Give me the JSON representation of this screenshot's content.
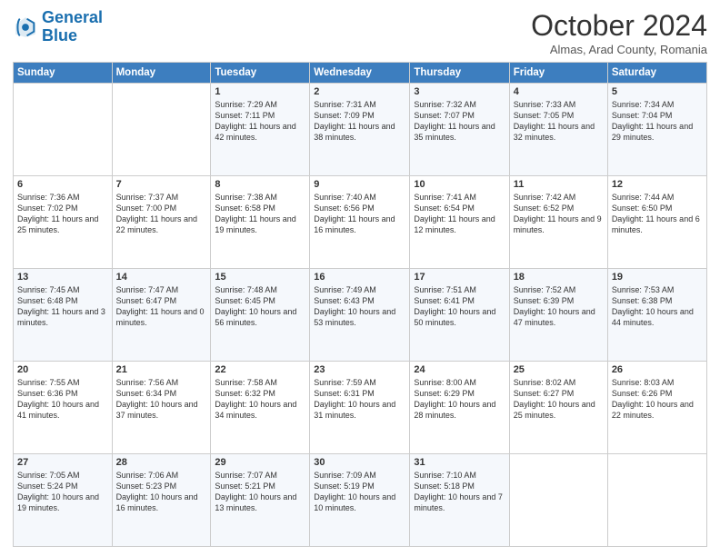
{
  "header": {
    "logo_line1": "General",
    "logo_line2": "Blue",
    "month_title": "October 2024",
    "subtitle": "Almas, Arad County, Romania"
  },
  "weekdays": [
    "Sunday",
    "Monday",
    "Tuesday",
    "Wednesday",
    "Thursday",
    "Friday",
    "Saturday"
  ],
  "rows": [
    [
      {
        "day": "",
        "text": ""
      },
      {
        "day": "",
        "text": ""
      },
      {
        "day": "1",
        "text": "Sunrise: 7:29 AM\nSunset: 7:11 PM\nDaylight: 11 hours and 42 minutes."
      },
      {
        "day": "2",
        "text": "Sunrise: 7:31 AM\nSunset: 7:09 PM\nDaylight: 11 hours and 38 minutes."
      },
      {
        "day": "3",
        "text": "Sunrise: 7:32 AM\nSunset: 7:07 PM\nDaylight: 11 hours and 35 minutes."
      },
      {
        "day": "4",
        "text": "Sunrise: 7:33 AM\nSunset: 7:05 PM\nDaylight: 11 hours and 32 minutes."
      },
      {
        "day": "5",
        "text": "Sunrise: 7:34 AM\nSunset: 7:04 PM\nDaylight: 11 hours and 29 minutes."
      }
    ],
    [
      {
        "day": "6",
        "text": "Sunrise: 7:36 AM\nSunset: 7:02 PM\nDaylight: 11 hours and 25 minutes."
      },
      {
        "day": "7",
        "text": "Sunrise: 7:37 AM\nSunset: 7:00 PM\nDaylight: 11 hours and 22 minutes."
      },
      {
        "day": "8",
        "text": "Sunrise: 7:38 AM\nSunset: 6:58 PM\nDaylight: 11 hours and 19 minutes."
      },
      {
        "day": "9",
        "text": "Sunrise: 7:40 AM\nSunset: 6:56 PM\nDaylight: 11 hours and 16 minutes."
      },
      {
        "day": "10",
        "text": "Sunrise: 7:41 AM\nSunset: 6:54 PM\nDaylight: 11 hours and 12 minutes."
      },
      {
        "day": "11",
        "text": "Sunrise: 7:42 AM\nSunset: 6:52 PM\nDaylight: 11 hours and 9 minutes."
      },
      {
        "day": "12",
        "text": "Sunrise: 7:44 AM\nSunset: 6:50 PM\nDaylight: 11 hours and 6 minutes."
      }
    ],
    [
      {
        "day": "13",
        "text": "Sunrise: 7:45 AM\nSunset: 6:48 PM\nDaylight: 11 hours and 3 minutes."
      },
      {
        "day": "14",
        "text": "Sunrise: 7:47 AM\nSunset: 6:47 PM\nDaylight: 11 hours and 0 minutes."
      },
      {
        "day": "15",
        "text": "Sunrise: 7:48 AM\nSunset: 6:45 PM\nDaylight: 10 hours and 56 minutes."
      },
      {
        "day": "16",
        "text": "Sunrise: 7:49 AM\nSunset: 6:43 PM\nDaylight: 10 hours and 53 minutes."
      },
      {
        "day": "17",
        "text": "Sunrise: 7:51 AM\nSunset: 6:41 PM\nDaylight: 10 hours and 50 minutes."
      },
      {
        "day": "18",
        "text": "Sunrise: 7:52 AM\nSunset: 6:39 PM\nDaylight: 10 hours and 47 minutes."
      },
      {
        "day": "19",
        "text": "Sunrise: 7:53 AM\nSunset: 6:38 PM\nDaylight: 10 hours and 44 minutes."
      }
    ],
    [
      {
        "day": "20",
        "text": "Sunrise: 7:55 AM\nSunset: 6:36 PM\nDaylight: 10 hours and 41 minutes."
      },
      {
        "day": "21",
        "text": "Sunrise: 7:56 AM\nSunset: 6:34 PM\nDaylight: 10 hours and 37 minutes."
      },
      {
        "day": "22",
        "text": "Sunrise: 7:58 AM\nSunset: 6:32 PM\nDaylight: 10 hours and 34 minutes."
      },
      {
        "day": "23",
        "text": "Sunrise: 7:59 AM\nSunset: 6:31 PM\nDaylight: 10 hours and 31 minutes."
      },
      {
        "day": "24",
        "text": "Sunrise: 8:00 AM\nSunset: 6:29 PM\nDaylight: 10 hours and 28 minutes."
      },
      {
        "day": "25",
        "text": "Sunrise: 8:02 AM\nSunset: 6:27 PM\nDaylight: 10 hours and 25 minutes."
      },
      {
        "day": "26",
        "text": "Sunrise: 8:03 AM\nSunset: 6:26 PM\nDaylight: 10 hours and 22 minutes."
      }
    ],
    [
      {
        "day": "27",
        "text": "Sunrise: 7:05 AM\nSunset: 5:24 PM\nDaylight: 10 hours and 19 minutes."
      },
      {
        "day": "28",
        "text": "Sunrise: 7:06 AM\nSunset: 5:23 PM\nDaylight: 10 hours and 16 minutes."
      },
      {
        "day": "29",
        "text": "Sunrise: 7:07 AM\nSunset: 5:21 PM\nDaylight: 10 hours and 13 minutes."
      },
      {
        "day": "30",
        "text": "Sunrise: 7:09 AM\nSunset: 5:19 PM\nDaylight: 10 hours and 10 minutes."
      },
      {
        "day": "31",
        "text": "Sunrise: 7:10 AM\nSunset: 5:18 PM\nDaylight: 10 hours and 7 minutes."
      },
      {
        "day": "",
        "text": ""
      },
      {
        "day": "",
        "text": ""
      }
    ]
  ]
}
